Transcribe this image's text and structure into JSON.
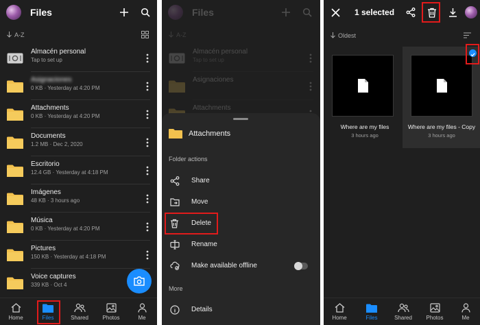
{
  "colors": {
    "background": "#1f1f1f",
    "accent": "#1a8dff",
    "highlight": "#e21b1b",
    "sheet": "#272727"
  },
  "panel1": {
    "title": "Files",
    "sort_label": "A-Z",
    "icons": [
      "plus-icon",
      "search-icon",
      "grid-view-icon",
      "more-vertical-icon"
    ],
    "items": [
      {
        "name": "Almacén personal",
        "sub": "Tap to set up",
        "kind": "vault"
      },
      {
        "name": "Asignaciones",
        "sub": "0 KB · Yesterday at 4:20 PM",
        "kind": "folder",
        "blurred": true
      },
      {
        "name": "Attachments",
        "sub": "0 KB · Yesterday at 4:20 PM",
        "kind": "folder"
      },
      {
        "name": "Documents",
        "sub": "1.2 MB · Dec 2, 2020",
        "kind": "folder"
      },
      {
        "name": "Escritorio",
        "sub": "12.4 GB · Yesterday at 4:18 PM",
        "kind": "folder"
      },
      {
        "name": "Imágenes",
        "sub": "48 KB · 3 hours ago",
        "kind": "folder"
      },
      {
        "name": "Música",
        "sub": "0 KB · Yesterday at 4:20 PM",
        "kind": "folder"
      },
      {
        "name": "Pictures",
        "sub": "150 KB · Yesterday at 4:18 PM",
        "kind": "folder"
      },
      {
        "name": "Voice captures",
        "sub": "339 KB · Oct 4",
        "kind": "folder"
      }
    ],
    "nav": [
      {
        "label": "Home",
        "icon": "home-icon"
      },
      {
        "label": "Files",
        "icon": "folder-icon",
        "active": true
      },
      {
        "label": "Shared",
        "icon": "people-icon"
      },
      {
        "label": "Photos",
        "icon": "photo-icon"
      },
      {
        "label": "Me",
        "icon": "person-icon"
      }
    ]
  },
  "panel2": {
    "title": "Files",
    "sort_label": "A-Z",
    "sheet_title": "Attachments",
    "section_folder": "Folder actions",
    "actions": [
      {
        "label": "Share",
        "icon": "share-icon"
      },
      {
        "label": "Move",
        "icon": "move-icon"
      },
      {
        "label": "Delete",
        "icon": "trash-icon",
        "highlighted": true
      },
      {
        "label": "Rename",
        "icon": "rename-icon"
      },
      {
        "label": "Make available offline",
        "icon": "offline-icon",
        "toggle": false
      }
    ],
    "section_more": "More",
    "more_actions": [
      {
        "label": "Details",
        "icon": "info-icon"
      }
    ],
    "dim_items": [
      {
        "name": "Almacén personal",
        "sub": "Tap to set up"
      },
      {
        "name": "Asignaciones",
        "sub": ""
      },
      {
        "name": "Attachments",
        "sub": ""
      }
    ]
  },
  "panel3": {
    "header": "1 selected",
    "sort_label": "Oldest",
    "files": [
      {
        "name": "Where are my files",
        "time": "3 hours ago",
        "selected": false
      },
      {
        "name": "Where are my files - Copy",
        "time": "3 hours ago",
        "selected": true
      }
    ],
    "nav": [
      {
        "label": "Home",
        "icon": "home-icon"
      },
      {
        "label": "Files",
        "icon": "folder-icon",
        "active": true
      },
      {
        "label": "Shared",
        "icon": "people-icon"
      },
      {
        "label": "Photos",
        "icon": "photo-icon"
      },
      {
        "label": "Me",
        "icon": "person-icon"
      }
    ]
  }
}
